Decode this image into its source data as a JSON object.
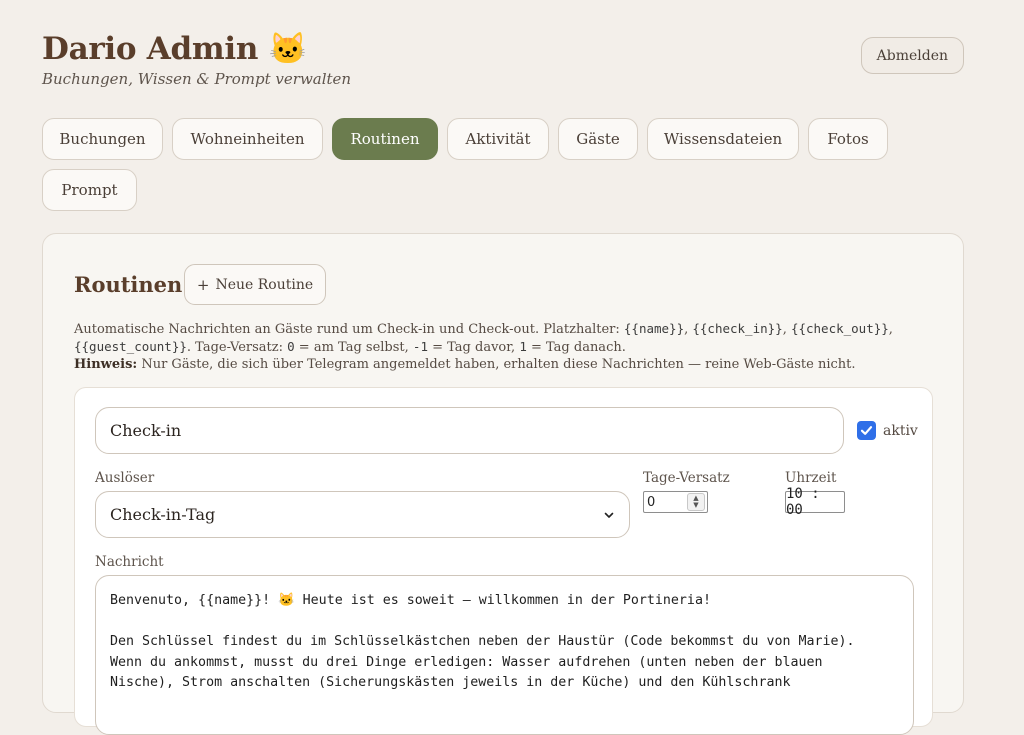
{
  "header": {
    "title": "Dario Admin 🐱",
    "subtitle": "Buchungen, Wissen & Prompt verwalten",
    "logout_label": "Abmelden"
  },
  "tabs": [
    {
      "label": "Buchungen",
      "active": false
    },
    {
      "label": "Wohneinheiten",
      "active": false
    },
    {
      "label": "Routinen",
      "active": true
    },
    {
      "label": "Aktivität",
      "active": false
    },
    {
      "label": "Gäste",
      "active": false
    },
    {
      "label": "Wissensdateien",
      "active": false
    },
    {
      "label": "Fotos",
      "active": false
    },
    {
      "label": "Prompt",
      "active": false
    }
  ],
  "routines": {
    "title": "Routinen",
    "new_button_icon": "plus-icon",
    "new_button_label": "Neue Routine",
    "description": {
      "intro": "Automatische Nachrichten an Gäste rund um Check-in und Check-out. Platzhalter: ",
      "placeholder_name": "{{name}}",
      "sep1": ", ",
      "placeholder_check_in": "{{check_in}}",
      "sep2": ", ",
      "placeholder_check_out": "{{check_out}}",
      "sep3": ",",
      "placeholder_guest_count": "{{guest_count}}",
      "offset_text_1": ". Tage-Versatz: ",
      "offset_zero": "0",
      "offset_text_2": " = am Tag selbst, ",
      "offset_minus": "-1",
      "offset_text_3": " = Tag davor, ",
      "offset_plus": "1",
      "offset_text_4": " = Tag danach.",
      "hint_label": "Hinweis:",
      "hint_text": " Nur Gäste, die sich über Telegram angemeldet haben, erhalten diese Nachrichten — reine Web-Gäste nicht."
    },
    "card": {
      "name_value": "Check-in",
      "active_checked": true,
      "active_label": "aktiv",
      "trigger_label": "Auslöser",
      "trigger_value": "Check-in-Tag",
      "offset_label": "Tage-Versatz",
      "offset_value": "0",
      "time_label": "Uhrzeit",
      "time_value": "10 : 00",
      "message_label": "Nachricht",
      "message_value": "Benvenuto, {{name}}! 🐱 Heute ist es soweit – willkommen in der Portineria!\n\nDen Schlüssel findest du im Schlüsselkästchen neben der Haustür (Code bekommst du von Marie).\nWenn du ankommst, musst du drei Dinge erledigen: Wasser aufdrehen (unten neben der blauen\nNische), Strom anschalten (Sicherungskästen jeweils in der Küche) und den Kühlschrank"
    }
  },
  "colors": {
    "background": "#f3efea",
    "accent_active_tab": "#6b7c4e",
    "brand_text": "#5a3e2b",
    "checkbox": "#2f6fe8"
  }
}
